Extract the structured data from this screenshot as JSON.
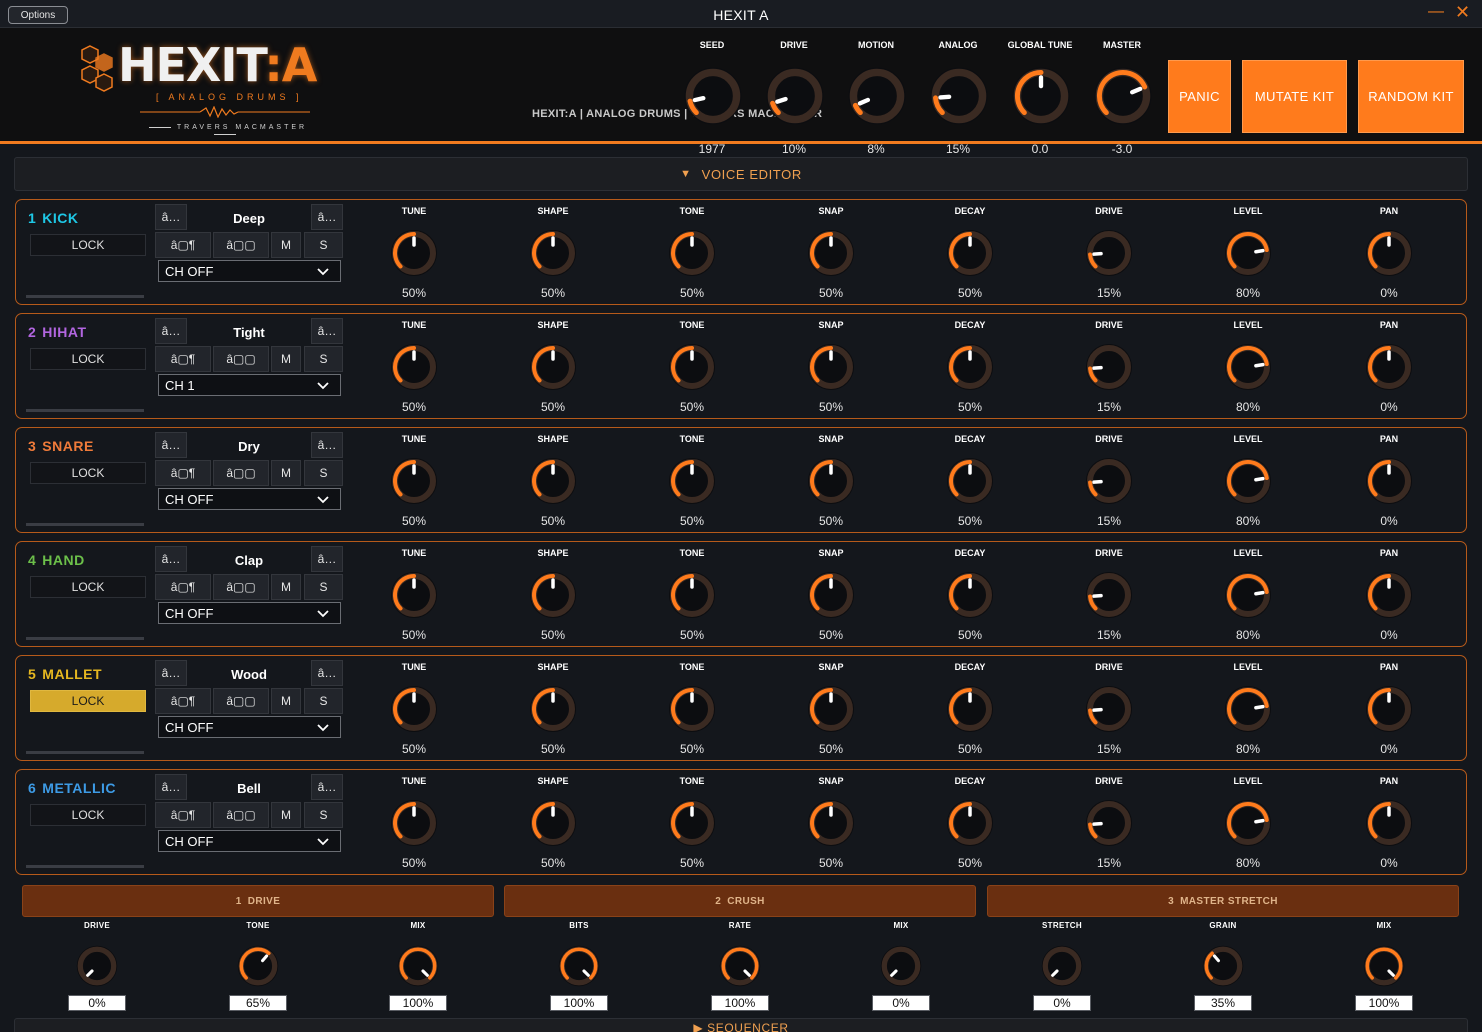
{
  "window": {
    "title": "HEXIT A",
    "options_label": "Options",
    "minimize_glyph": "—",
    "close_glyph": "✕"
  },
  "header": {
    "logo": {
      "word_main": "HEXIT",
      "word_colon": ":",
      "word_suffix": "A",
      "subtitle": "[ ANALOG DRUMS ]",
      "author": "TRAVERS MACMASTER"
    },
    "tagline": "HEXIT:A  |  ANALOG DRUMS  |  TRAVERS MACMASTER",
    "global_knobs": [
      {
        "label": "SEED",
        "value": "1977",
        "level": 0.12
      },
      {
        "label": "DRIVE",
        "value": "10%",
        "level": 0.1
      },
      {
        "label": "MOTION",
        "value": "8%",
        "level": 0.08
      },
      {
        "label": "ANALOG",
        "value": "15%",
        "level": 0.15
      },
      {
        "label": "GLOBAL TUNE",
        "value": "0.0",
        "level": 0.5
      },
      {
        "label": "MASTER",
        "value": "-3.0",
        "level": 0.75
      }
    ],
    "buttons": {
      "panic": "PANIC",
      "mutate": "MUTATE KIT",
      "random": "RANDOM KIT"
    }
  },
  "voice_editor": {
    "title": "VOICE EDITOR",
    "collapse_glyph": "▼",
    "param_labels": [
      "TUNE",
      "SHAPE",
      "TONE",
      "SNAP",
      "DECAY",
      "DRIVE",
      "LEVEL",
      "PAN"
    ],
    "voices": [
      {
        "num": "1",
        "name": "KICK",
        "color": "#1ec8e6",
        "preset": "Deep",
        "channel": "CH OFF",
        "lock": "LOCK",
        "locked": false,
        "params": [
          {
            "value": "50%",
            "level": 0.5
          },
          {
            "value": "50%",
            "level": 0.5
          },
          {
            "value": "50%",
            "level": 0.5
          },
          {
            "value": "50%",
            "level": 0.5
          },
          {
            "value": "50%",
            "level": 0.5
          },
          {
            "value": "15%",
            "level": 0.15
          },
          {
            "value": "80%",
            "level": 0.8
          },
          {
            "value": "0%",
            "level": 0.5
          }
        ]
      },
      {
        "num": "2",
        "name": "HIHAT",
        "color": "#b266e0",
        "preset": "Tight",
        "channel": "CH 1",
        "lock": "LOCK",
        "locked": false,
        "params": [
          {
            "value": "50%",
            "level": 0.5
          },
          {
            "value": "50%",
            "level": 0.5
          },
          {
            "value": "50%",
            "level": 0.5
          },
          {
            "value": "50%",
            "level": 0.5
          },
          {
            "value": "50%",
            "level": 0.5
          },
          {
            "value": "15%",
            "level": 0.15
          },
          {
            "value": "80%",
            "level": 0.8
          },
          {
            "value": "0%",
            "level": 0.5
          }
        ]
      },
      {
        "num": "3",
        "name": "SNARE",
        "color": "#f07b3a",
        "preset": "Dry",
        "channel": "CH OFF",
        "lock": "LOCK",
        "locked": false,
        "params": [
          {
            "value": "50%",
            "level": 0.5
          },
          {
            "value": "50%",
            "level": 0.5
          },
          {
            "value": "50%",
            "level": 0.5
          },
          {
            "value": "50%",
            "level": 0.5
          },
          {
            "value": "50%",
            "level": 0.5
          },
          {
            "value": "15%",
            "level": 0.15
          },
          {
            "value": "80%",
            "level": 0.8
          },
          {
            "value": "0%",
            "level": 0.5
          }
        ]
      },
      {
        "num": "4",
        "name": "HAND",
        "color": "#6cc04a",
        "preset": "Clap",
        "channel": "CH OFF",
        "lock": "LOCK",
        "locked": false,
        "params": [
          {
            "value": "50%",
            "level": 0.5
          },
          {
            "value": "50%",
            "level": 0.5
          },
          {
            "value": "50%",
            "level": 0.5
          },
          {
            "value": "50%",
            "level": 0.5
          },
          {
            "value": "50%",
            "level": 0.5
          },
          {
            "value": "15%",
            "level": 0.15
          },
          {
            "value": "80%",
            "level": 0.8
          },
          {
            "value": "0%",
            "level": 0.5
          }
        ]
      },
      {
        "num": "5",
        "name": "MALLET",
        "color": "#e6b820",
        "preset": "Wood",
        "channel": "CH OFF",
        "lock": "LOCK",
        "locked": true,
        "params": [
          {
            "value": "50%",
            "level": 0.5
          },
          {
            "value": "50%",
            "level": 0.5
          },
          {
            "value": "50%",
            "level": 0.5
          },
          {
            "value": "50%",
            "level": 0.5
          },
          {
            "value": "50%",
            "level": 0.5
          },
          {
            "value": "15%",
            "level": 0.15
          },
          {
            "value": "80%",
            "level": 0.8
          },
          {
            "value": "0%",
            "level": 0.5
          }
        ]
      },
      {
        "num": "6",
        "name": "METALLIC",
        "color": "#3d9be6",
        "preset": "Bell",
        "channel": "CH OFF",
        "lock": "LOCK",
        "locked": false,
        "params": [
          {
            "value": "50%",
            "level": 0.5
          },
          {
            "value": "50%",
            "level": 0.5
          },
          {
            "value": "50%",
            "level": 0.5
          },
          {
            "value": "50%",
            "level": 0.5
          },
          {
            "value": "50%",
            "level": 0.5
          },
          {
            "value": "15%",
            "level": 0.15
          },
          {
            "value": "80%",
            "level": 0.8
          },
          {
            "value": "0%",
            "level": 0.5
          }
        ]
      }
    ],
    "voice_buttons": {
      "prev": "â…",
      "next": "â…",
      "play": "â▢¶",
      "seq": "â▢▢",
      "mute": "M",
      "solo": "S"
    }
  },
  "fx": {
    "tabs": [
      {
        "num": "1",
        "label": "DRIVE"
      },
      {
        "num": "2",
        "label": "CRUSH"
      },
      {
        "num": "3",
        "label": "MASTER STRETCH"
      }
    ],
    "knobs": [
      {
        "label": "DRIVE",
        "value": "0%",
        "level": 0.0
      },
      {
        "label": "TONE",
        "value": "65%",
        "level": 0.65
      },
      {
        "label": "MIX",
        "value": "100%",
        "level": 1.0
      },
      {
        "label": "BITS",
        "value": "100%",
        "level": 1.0
      },
      {
        "label": "RATE",
        "value": "100%",
        "level": 1.0
      },
      {
        "label": "MIX",
        "value": "0%",
        "level": 0.0
      },
      {
        "label": "STRETCH",
        "value": "0%",
        "level": 0.0
      },
      {
        "label": "GRAIN",
        "value": "35%",
        "level": 0.35
      },
      {
        "label": "MIX",
        "value": "100%",
        "level": 1.0
      }
    ]
  },
  "sequencer": {
    "title": "▶  SEQUENCER"
  },
  "colors": {
    "accent": "#f07b1f",
    "panel_border": "#b65a1a",
    "knob_track": "#3a2a22",
    "fx_tab": "#6a2f10",
    "lock_active": "#d6aa2c"
  }
}
